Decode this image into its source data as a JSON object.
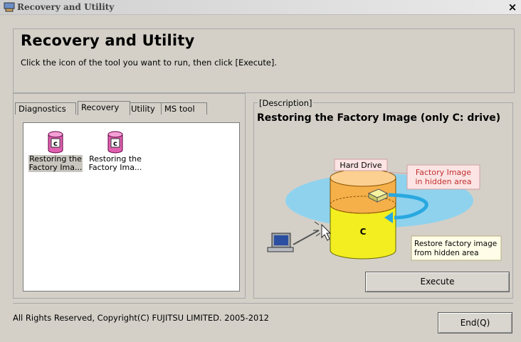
{
  "window": {
    "title": "Recovery and Utility",
    "close_glyph": "×"
  },
  "header": {
    "title": "Recovery and Utility",
    "instruction": "Click the icon of the tool you want to run, then click [Execute]."
  },
  "tabs": [
    {
      "label": "Diagnostics"
    },
    {
      "label": "Recovery",
      "active": true
    },
    {
      "label": "Utility"
    },
    {
      "label": "MS tool"
    }
  ],
  "tools": [
    {
      "line1": "Restoring the",
      "line2": "Factory Ima...",
      "selected": true,
      "icon": "cylinder-c-icon"
    },
    {
      "line1": "Restoring the",
      "line2": "Factory Ima...",
      "selected": false,
      "icon": "cylinder-c-icon"
    }
  ],
  "description": {
    "legend": "[Description]",
    "title": "Restoring the Factory Image (only C: drive)",
    "illustration": {
      "hard_drive_label": "Hard Drive",
      "drive_letter": "C",
      "callout_1_line1": "Factory Image",
      "callout_1_line2": "in hidden area",
      "callout_2_line1": "Restore factory image",
      "callout_2_line2": "from hidden area"
    }
  },
  "buttons": {
    "execute": "Execute",
    "end": "End(Q)"
  },
  "footer": {
    "copyright": "All Rights Reserved, Copyright(C) FUJITSU LIMITED. 2005-2012"
  },
  "colors": {
    "window_bg": "#d4d0c8",
    "list_bg": "#ffffff",
    "drive_yellow": "#f2ee20",
    "drive_orange": "#f2a030",
    "icon_pink": "#e060b0",
    "accent_blue": "#29a8e0"
  }
}
